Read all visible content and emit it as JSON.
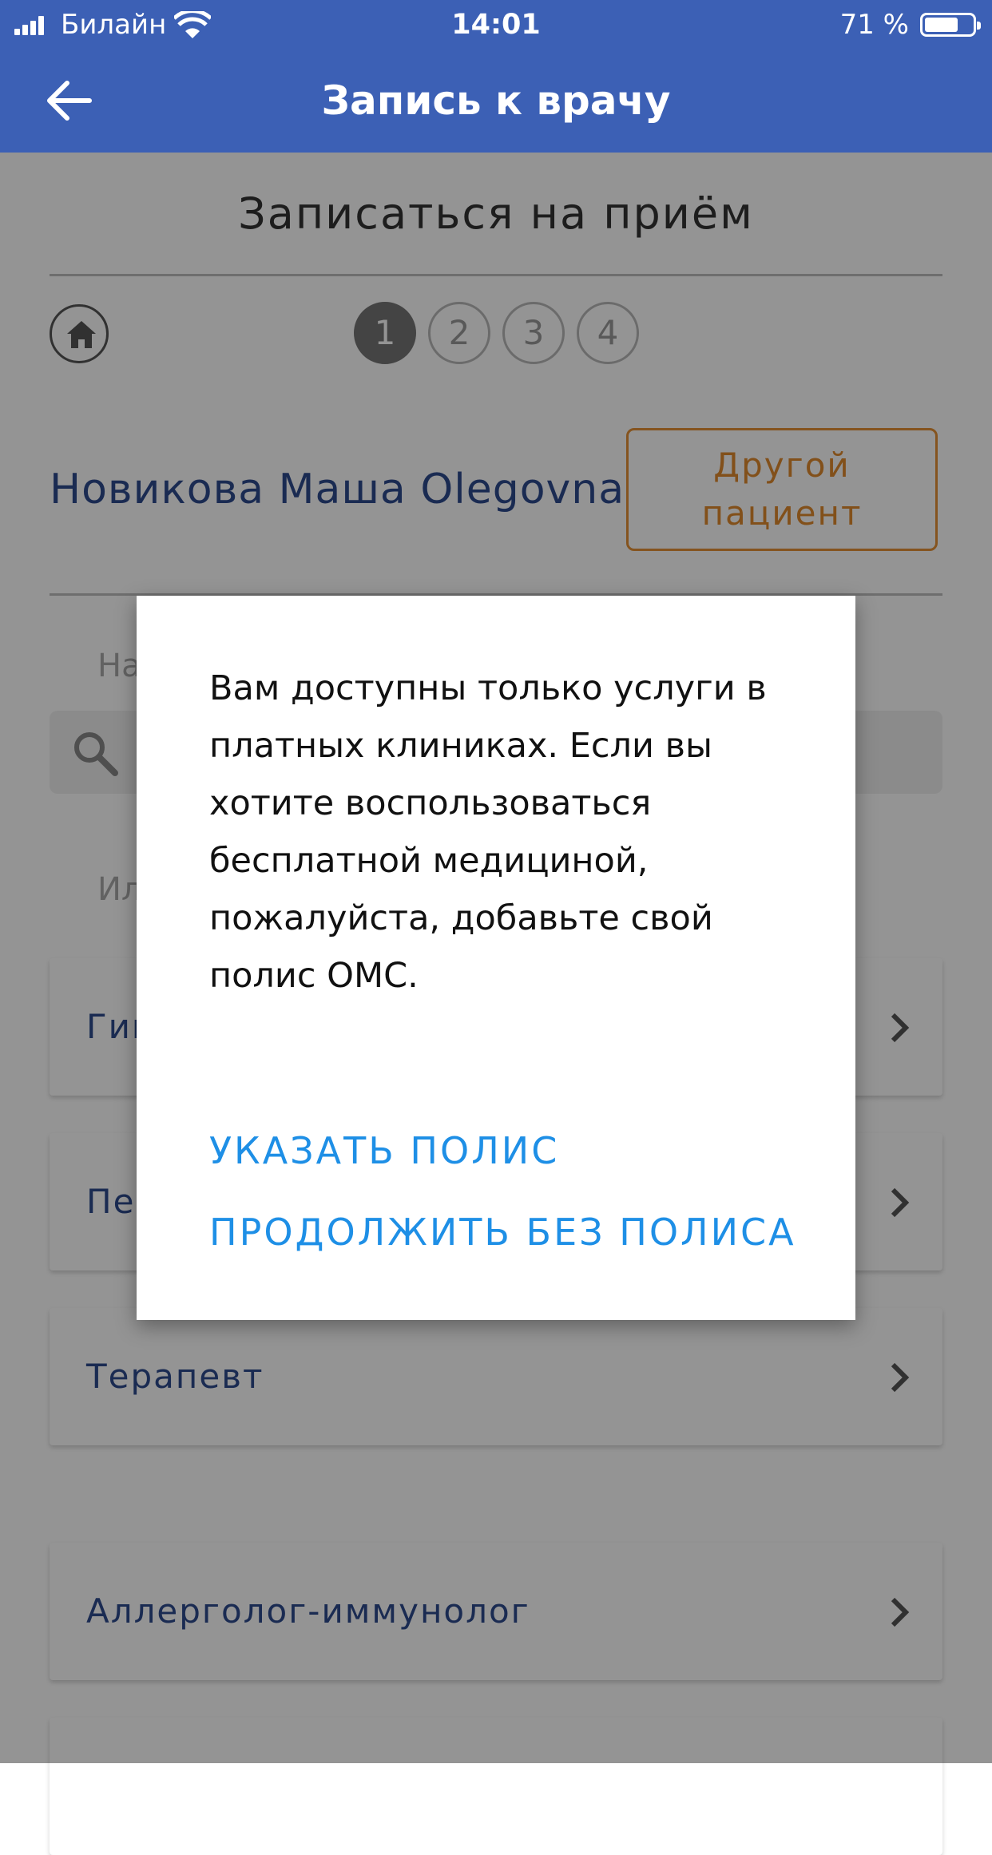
{
  "status_bar": {
    "carrier": "Билайн",
    "time": "14:01",
    "battery_percent": "71 %",
    "battery_level": 0.71
  },
  "header": {
    "title": "Запись к врачу",
    "back_icon": "arrow-left-icon",
    "background": "#3c60b5"
  },
  "page": {
    "section_title": "Записаться на приём",
    "steps": [
      "1",
      "2",
      "3",
      "4"
    ],
    "active_step": "1",
    "patient_name": "Новикова Маша Olegovna",
    "other_patient_button": {
      "line1": "Другой",
      "line2": "пациент"
    },
    "hint_1": "На",
    "hint_2": "Ил",
    "specialties": [
      "Гин",
      "Пед",
      "Терапевт",
      "Аллерголог-иммунолог"
    ]
  },
  "dialog": {
    "message_lines": [
      "Вам доступны только услуги в",
      "платных клиниках. Если вы",
      "хотите воспользоваться",
      "бесплатной медициной,",
      "пожалуйста, добавьте свой",
      "полис ОМС."
    ],
    "primary_action": "УКАЗАТЬ ПОЛИС",
    "secondary_action": "ПРОДОЛЖИТЬ БЕЗ ПОЛИСА",
    "action_color": "#1e8fe6"
  }
}
